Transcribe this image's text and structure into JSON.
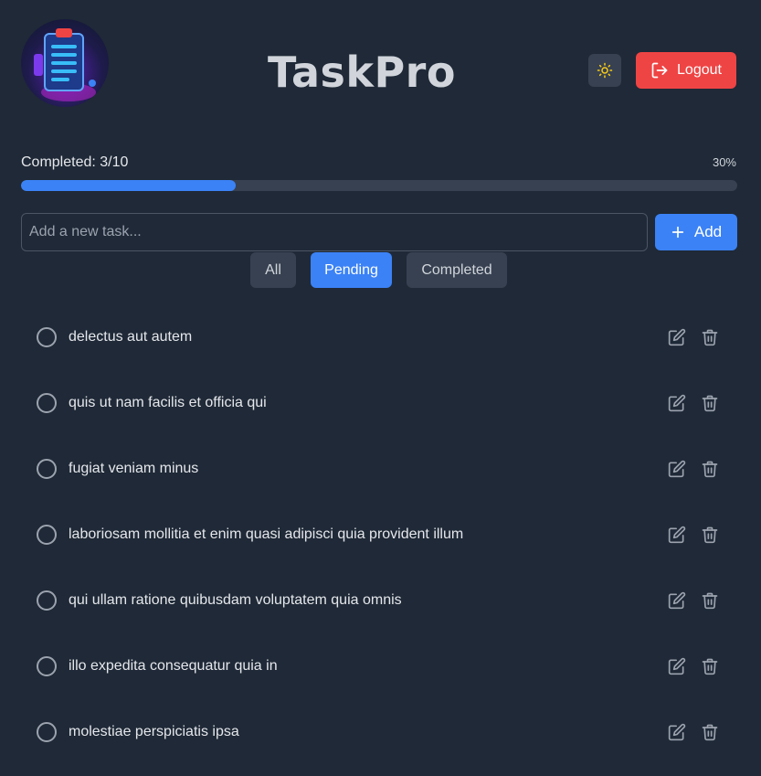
{
  "header": {
    "title": "TaskPro",
    "logo_icon": "clipboard-logo-icon",
    "theme_toggle_icon": "sun-icon",
    "logout_label": "Logout",
    "logout_icon": "logout-icon"
  },
  "progress": {
    "label": "Completed: 3/10",
    "percent_text": "30%",
    "fraction": 0.3
  },
  "add_task": {
    "placeholder": "Add a new task...",
    "value": "",
    "button_label": "Add",
    "button_icon": "plus-icon"
  },
  "filters": {
    "all": "All",
    "pending": "Pending",
    "completed": "Completed",
    "active": "pending"
  },
  "tasks": [
    {
      "text": "delectus aut autem",
      "completed": false
    },
    {
      "text": "quis ut nam facilis et officia qui",
      "completed": false
    },
    {
      "text": "fugiat veniam minus",
      "completed": false
    },
    {
      "text": "laboriosam mollitia et enim quasi adipisci quia provident illum",
      "completed": false
    },
    {
      "text": "qui ullam ratione quibusdam voluptatem quia omnis",
      "completed": false
    },
    {
      "text": "illo expedita consequatur quia in",
      "completed": false
    },
    {
      "text": "molestiae perspiciatis ipsa",
      "completed": false
    }
  ],
  "colors": {
    "background": "#1f2937",
    "accent": "#3b82f6",
    "danger": "#ef4444",
    "sun": "#facc15"
  }
}
